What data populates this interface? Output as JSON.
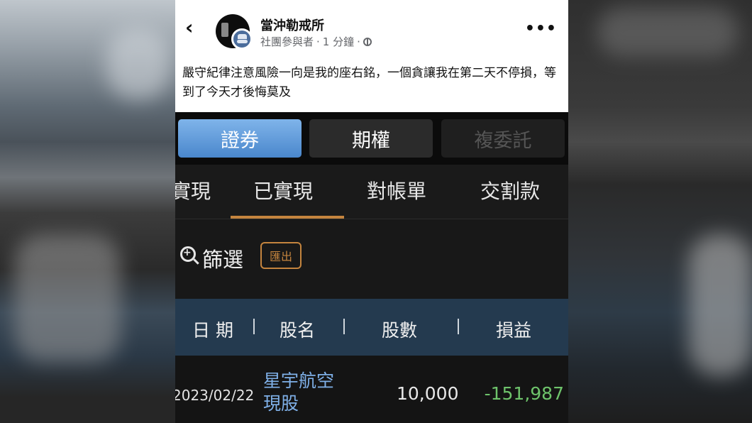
{
  "post": {
    "back_icon": "chevron-left-icon",
    "group_name": "當沖勒戒所",
    "member_role": "社團參與者",
    "time_ago": "1 分鐘",
    "more_icon": "more-dots-icon",
    "text": "嚴守紀律注意風險一向是我的座右銘，一個貪讓我在第二天不停損，等到了今天才後悔莫及"
  },
  "segments": [
    {
      "label": "證券",
      "active": true
    },
    {
      "label": "期權",
      "active": false
    },
    {
      "label": "複委託",
      "active": false
    }
  ],
  "tabs": [
    {
      "label": "實現",
      "active": false
    },
    {
      "label": "已實現",
      "active": true
    },
    {
      "label": "對帳單",
      "active": false
    },
    {
      "label": "交割款",
      "active": false
    }
  ],
  "filter": {
    "label": "篩選",
    "export_label": "匯出"
  },
  "table": {
    "headers": [
      "日 期",
      "股名",
      "股數",
      "損益"
    ],
    "rows": [
      {
        "date": "2023/02/22",
        "stock_name": "星宇航空",
        "stock_type": "現股",
        "shares": "10,000",
        "pnl": "-151,987"
      }
    ]
  },
  "colors": {
    "accent": "#c4843e",
    "active_segment": "#5d9ad9",
    "table_header": "#243a4f",
    "stock_link": "#7fb0e8",
    "pnl": "#6ec36b"
  }
}
